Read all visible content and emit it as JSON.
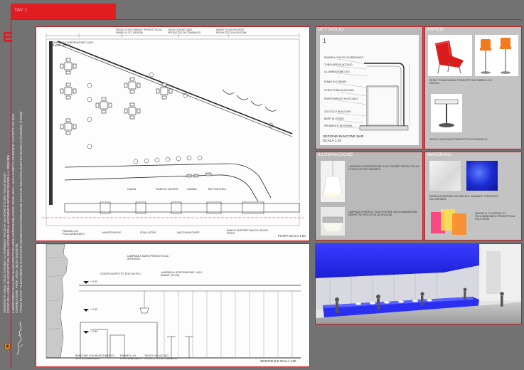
{
  "header": {
    "label": "TAV 1"
  },
  "sidebar": {
    "university": "UNIVERSITA' DEGLI STUDI DI ROMA \"LA SAPIENZA\" FACOLTA' DI ARCHITETTURA \"VALLE GIULIA\"",
    "course": "CORSO DI LAUREA IN ARCHITETTURA DEGLI INTERNI ED ALLESTIMENTO  INTERIOR DESIGN A.A. 2004/2005",
    "lab": "LABORATORIO DI LAUREA IN ARCHITETTURA DEGLI INTERNI    RELATORE: PROF. ARCH. LUCIA PANETTA   STUDENTE: CIAFFETTI VALERIA",
    "advisor": "CORRELATORE: PROF. ARCH. NILDA VALENTIN",
    "thesis": "TITOLO DI TESI: \"ALLESTIMENTO DI UN POLIFUNZIONALE DI PRODUZIONE DI DATI DI INDUSTRIA ELETTROTECNICA A PARIGINO (TRENI)\""
  },
  "plan": {
    "labels": [
      "LAMPADA A SOSPENSIONE \"LADY SHADE\" (FLOS)",
      "SEDIA \"COACCINSKA\" PRODOTTA DA FABRO & CO. DESIGN",
      "TAVOLO IN ACCIAIO PRODOTTO DA TRABALDO",
      "FARETTO AD INCASSO PRODOTTO DA IGUZZINI",
      "CASSA",
      "PIANO DI LAVORO",
      "LAVABO",
      "BOTTIGLIERIA",
      "PANNELLI IN POLICARBONATO",
      "LAVASTOVIGLIE",
      "FRULLATORI",
      "MACCHINA CAFFE'",
      "BANCO DESSERT  BANCO GELATI  FRIGO"
    ],
    "scale_label": "PIANTA SCALA 1:50"
  },
  "dettaglio": {
    "title": "DETTAGLIO",
    "number": "1",
    "notes": [
      "PANNELLO IN POLICARBONATO",
      "TUBOLARE IN ACCIAIO",
      "ILLUMINAZIONE LED",
      "PIANO IN CORIAN",
      "STRUTTURA IN ACCIAIO",
      "RIVESTIMENTO IN ACCIAIO",
      "ZOCCOLO IN ACCIAIO",
      "BASE IN LEGNO",
      "PAVIMENTO IN RESINA"
    ],
    "caption": "SEZIONE BANCONE BAR",
    "scale": "SCALA 1:10"
  },
  "arredi": {
    "title": "ARREDI",
    "caption1": "SEDIE \"COACCINSKA\" PRODOTTE DA FABRO & CO. DESIGN",
    "caption2": "TAVOLO IN ACCIAIO PRODOTTO DA TRABALDO"
  },
  "illuminazione": {
    "title": "ILLUMINAZIONE",
    "item1": "LAMPADA A SOSPENSIONE \"LADY SHADE\" PRODOTTA DA FLOS IN VETRO SATINATO",
    "item2": "LAMPADA A PARETE \"SLIM SYSTEM\" AD ILLUMINAZIONE INDIRETTA PRODOTTA DA IGUZZINI"
  },
  "materiali": {
    "title": "MATERIALI",
    "item1": "RESINA STAMPATA COLORE BLU \"DIAMANT\" PRODOTTA DA CARRERA",
    "item2": "PANNELLI \"CLARISSA\" IN POLICARBONATO PRODOTTI DA POLYFORM"
  },
  "section": {
    "labels": [
      "LAMPADA A MURO PRODOTTA DA ARTEMIDE",
      "CONTROSOFFITTO TESO IN PVC",
      "LAMPADA A SOSPENSIONE \"LADY SHADE\" (FLOS)",
      "+ 3.00",
      "+ 2.40",
      "+ 0.80",
      "BANCONE CON RIVESTIMENTO IN POLICARBONATO",
      "PANNELLI IN POLICARBONATO",
      "TAVOLO IN ACCIAIO PRODOTTO DA TRABALDO"
    ],
    "scale_label": "SEZIONE B-B SCALA 1:50"
  },
  "colors": {
    "accent": "#d0161c",
    "board": "#727272",
    "render_blue": "#1e22e0"
  }
}
